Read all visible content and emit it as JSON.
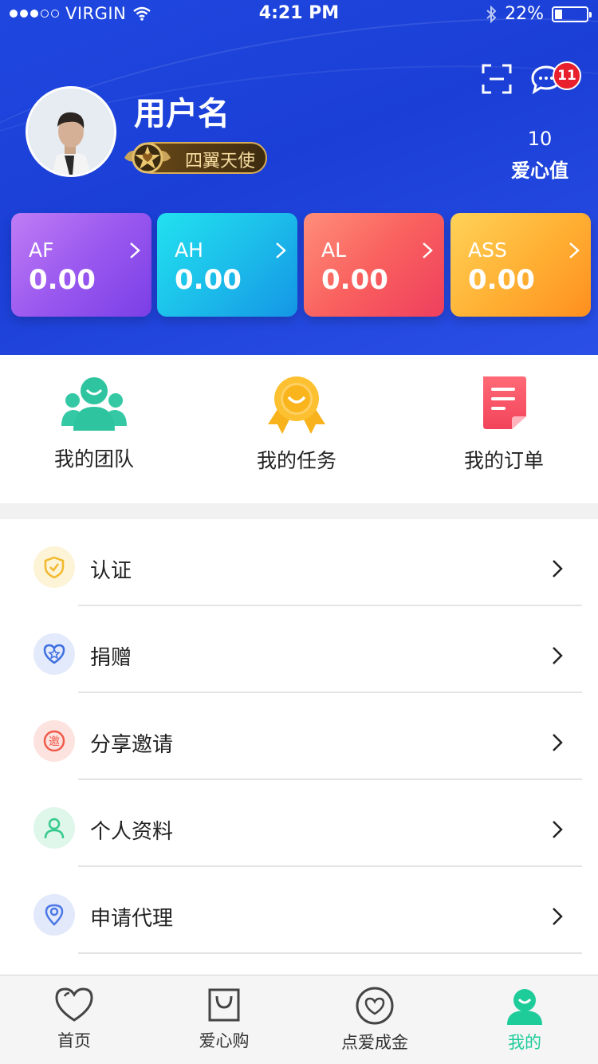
{
  "status_bar": {
    "carrier": "VIRGIN",
    "time": "4:21 PM",
    "battery": "22%"
  },
  "header": {
    "message_badge": "11",
    "username": "用户名",
    "level": "四翼天使",
    "love_value": {
      "number": "10",
      "label": "爱心值"
    }
  },
  "cards": [
    {
      "code": "AF",
      "value": "0.00"
    },
    {
      "code": "AH",
      "value": "0.00"
    },
    {
      "code": "AL",
      "value": "0.00"
    },
    {
      "code": "ASS",
      "value": "0.00"
    }
  ],
  "quick_grid": [
    {
      "label": "我的团队",
      "icon": "team-icon"
    },
    {
      "label": "我的任务",
      "icon": "medal-icon"
    },
    {
      "label": "我的订单",
      "icon": "order-icon"
    }
  ],
  "menu": [
    {
      "label": "认证",
      "icon": "shield-check-icon",
      "color": "#f5c33b"
    },
    {
      "label": "捐赠",
      "icon": "heart-star-icon",
      "color": "#3d6fe0"
    },
    {
      "label": "分享邀请",
      "icon": "invite-icon",
      "color": "#ef5a4a"
    },
    {
      "label": "个人资料",
      "icon": "person-icon",
      "color": "#36c98c"
    },
    {
      "label": "申请代理",
      "icon": "location-pin-icon",
      "color": "#4b77e8"
    }
  ],
  "tab_bar": [
    {
      "label": "首页",
      "icon": "heart-outline-icon",
      "active": false
    },
    {
      "label": "爱心购",
      "icon": "shopping-bag-icon",
      "active": false
    },
    {
      "label": "点爱成金",
      "icon": "heart-circle-icon",
      "active": false
    },
    {
      "label": "我的",
      "icon": "profile-icon",
      "active": true
    }
  ],
  "colors": {
    "header_blue": "#1f47e0",
    "accent_green": "#1ecc9a",
    "badge_red": "#e8202e"
  }
}
